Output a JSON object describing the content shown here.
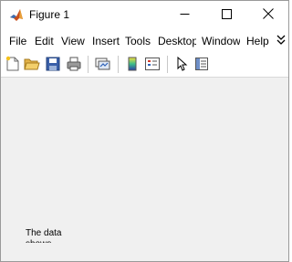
{
  "window": {
    "title": "Figure 1",
    "icon": "matlab-icon"
  },
  "window_controls": [
    "minimize-icon",
    "maximize-icon",
    "close-icon"
  ],
  "menu": {
    "items": [
      "File",
      "Edit",
      "View",
      "Insert",
      "Tools",
      "Desktop",
      "Window",
      "Help"
    ]
  },
  "toolbar": {
    "tools": [
      "new-figure-icon",
      "open-file-icon",
      "save-icon",
      "print-icon",
      "link-plot-icon",
      "insert-colorbar-icon",
      "insert-legend-icon",
      "edit-plot-icon",
      "property-inspector-icon"
    ]
  },
  "figure": {
    "text": "The data shows"
  },
  "colors": {
    "figure_background": "#f0f0f0",
    "title_background": "#ffffff"
  }
}
